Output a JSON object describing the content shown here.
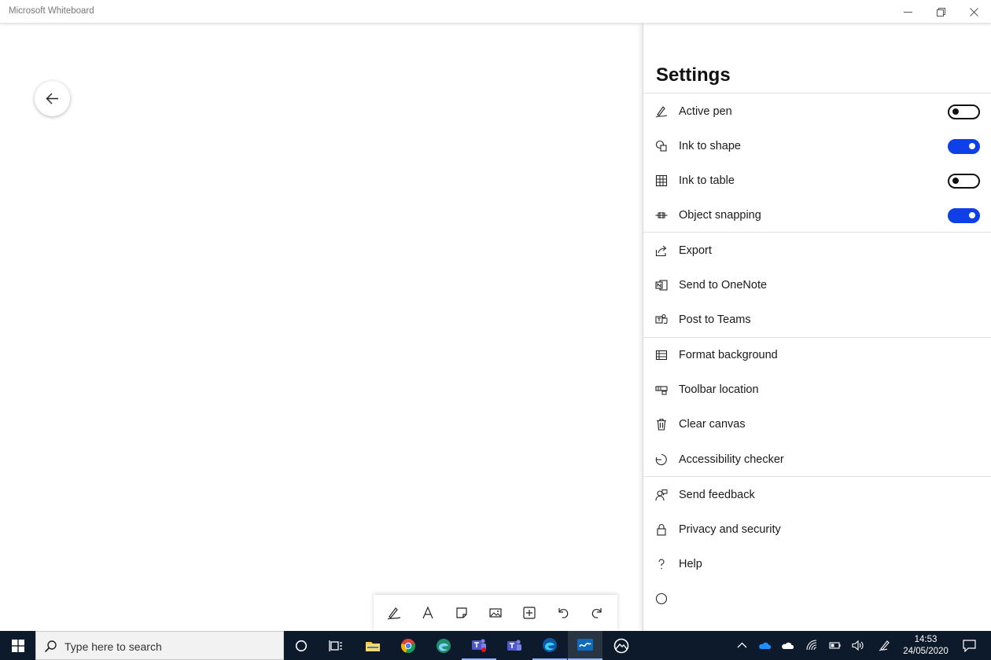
{
  "window": {
    "title": "Microsoft Whiteboard"
  },
  "settings": {
    "title": "Settings",
    "toggles": [
      {
        "label": "Active pen",
        "icon": "pen-icon",
        "on": false
      },
      {
        "label": "Ink to shape",
        "icon": "ink-to-shape-icon",
        "on": true
      },
      {
        "label": "Ink to table",
        "icon": "table-icon",
        "on": false
      },
      {
        "label": "Object snapping",
        "icon": "snapping-icon",
        "on": true
      }
    ],
    "share": [
      {
        "label": "Export",
        "icon": "export-icon"
      },
      {
        "label": "Send to OneNote",
        "icon": "onenote-icon"
      },
      {
        "label": "Post to Teams",
        "icon": "teams-icon"
      }
    ],
    "board": [
      {
        "label": "Format background",
        "icon": "background-icon"
      },
      {
        "label": "Toolbar location",
        "icon": "toolbar-location-icon"
      },
      {
        "label": "Clear canvas",
        "icon": "trash-icon"
      },
      {
        "label": "Accessibility checker",
        "icon": "accessibility-icon"
      }
    ],
    "support": [
      {
        "label": "Send feedback",
        "icon": "feedback-icon"
      },
      {
        "label": "Privacy and security",
        "icon": "lock-icon"
      },
      {
        "label": "Help",
        "icon": "help-icon"
      }
    ]
  },
  "toolbar": {
    "tools": [
      "pen-icon",
      "text-icon",
      "sticky-note-icon",
      "image-icon",
      "add-icon",
      "undo-icon",
      "redo-icon"
    ]
  },
  "taskbar": {
    "search_placeholder": "Type here to search",
    "time": "14:53",
    "date": "24/05/2020"
  },
  "colors": {
    "accent": "#0f3fe6",
    "taskbar": "#0d1a2b"
  }
}
